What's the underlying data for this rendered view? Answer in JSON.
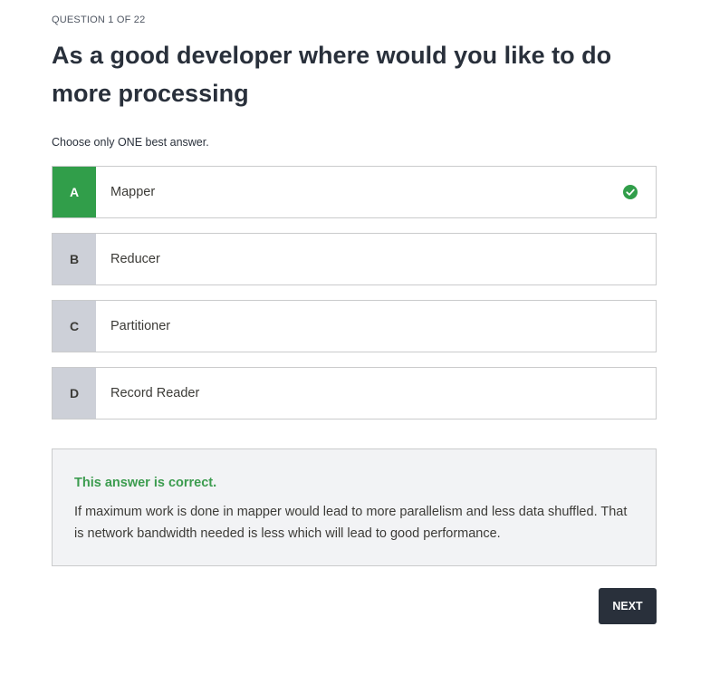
{
  "quiz": {
    "counter": "QUESTION 1 OF 22",
    "question": "As a good developer where would you like to do more processing",
    "instruction": "Choose only ONE best answer.",
    "options": [
      {
        "letter": "A",
        "text": "Mapper",
        "state": "correct",
        "icon": "check-circle-icon"
      },
      {
        "letter": "B",
        "text": "Reducer",
        "state": "neutral"
      },
      {
        "letter": "C",
        "text": "Partitioner",
        "state": "neutral"
      },
      {
        "letter": "D",
        "text": "Record Reader",
        "state": "neutral"
      }
    ],
    "feedback": {
      "status": "This answer is correct.",
      "explanation": "If maximum work is done in mapper would lead to more parallelism and less data shuffled. That is network bandwidth needed is less which will lead to good performance."
    },
    "next_label": "NEXT"
  },
  "colors": {
    "correct": "#319e4a",
    "neutral_letter_bg": "#cdd0d8",
    "button_bg": "#29303b",
    "feedback_bg": "#f2f3f5"
  }
}
